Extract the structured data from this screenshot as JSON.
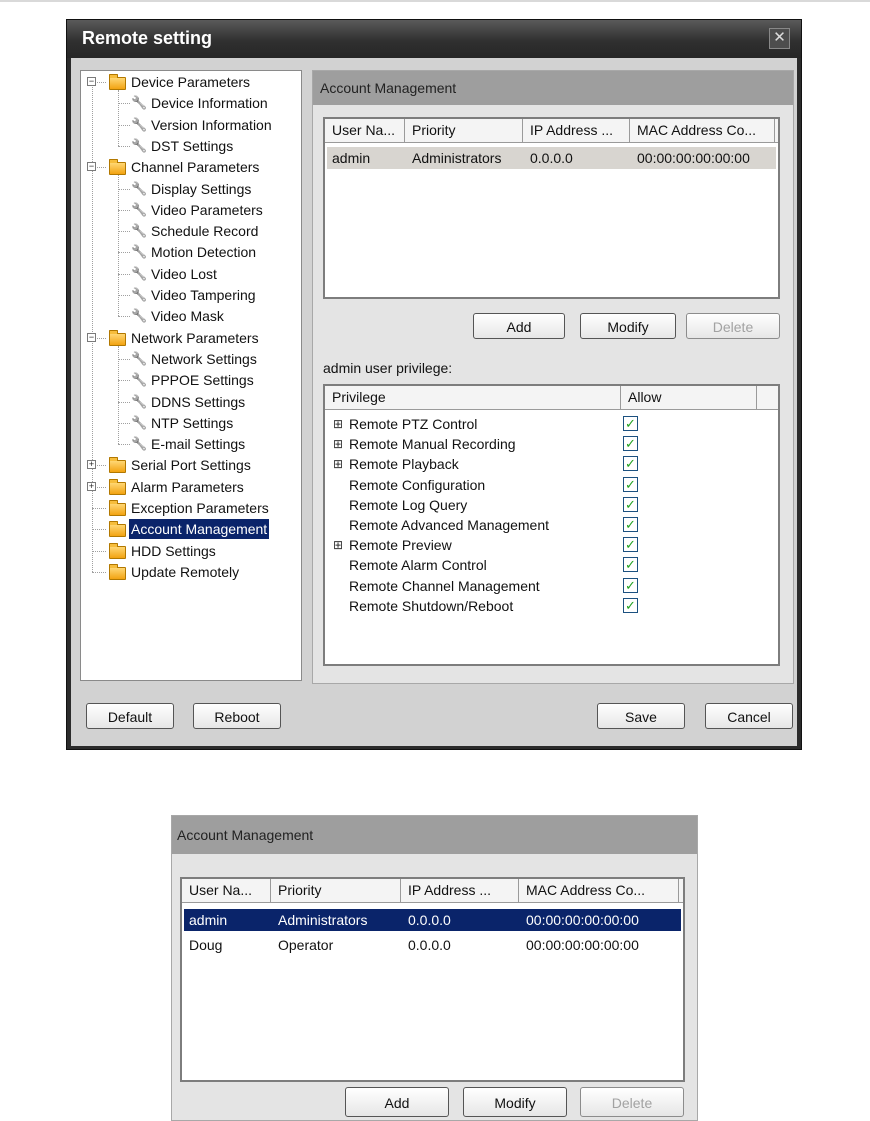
{
  "dialog": {
    "title": "Remote setting",
    "close_glyph": "✕",
    "buttons": {
      "default": "Default",
      "reboot": "Reboot",
      "save": "Save",
      "cancel": "Cancel"
    }
  },
  "tree": [
    {
      "label": "Device Parameters",
      "type": "folder",
      "level": 0,
      "expander": "−"
    },
    {
      "label": "Device Information",
      "type": "leaf",
      "level": 1
    },
    {
      "label": "Version Information",
      "type": "leaf",
      "level": 1
    },
    {
      "label": "DST Settings",
      "type": "leaf",
      "level": 1
    },
    {
      "label": "Channel Parameters",
      "type": "folder",
      "level": 0,
      "expander": "−"
    },
    {
      "label": "Display Settings",
      "type": "leaf",
      "level": 1
    },
    {
      "label": "Video Parameters",
      "type": "leaf",
      "level": 1
    },
    {
      "label": "Schedule Record",
      "type": "leaf",
      "level": 1
    },
    {
      "label": "Motion Detection",
      "type": "leaf",
      "level": 1
    },
    {
      "label": "Video Lost",
      "type": "leaf",
      "level": 1
    },
    {
      "label": "Video Tampering",
      "type": "leaf",
      "level": 1
    },
    {
      "label": "Video Mask",
      "type": "leaf",
      "level": 1
    },
    {
      "label": "Network Parameters",
      "type": "folder",
      "level": 0,
      "expander": "−"
    },
    {
      "label": "Network Settings",
      "type": "leaf",
      "level": 1
    },
    {
      "label": "PPPOE Settings",
      "type": "leaf",
      "level": 1
    },
    {
      "label": "DDNS Settings",
      "type": "leaf",
      "level": 1
    },
    {
      "label": "NTP Settings",
      "type": "leaf",
      "level": 1
    },
    {
      "label": "E-mail Settings",
      "type": "leaf",
      "level": 1
    },
    {
      "label": "Serial Port Settings",
      "type": "folder",
      "level": 0,
      "expander": "+"
    },
    {
      "label": "Alarm Parameters",
      "type": "folder",
      "level": 0,
      "expander": "+"
    },
    {
      "label": "Exception Parameters",
      "type": "folder",
      "level": 0
    },
    {
      "label": "Account Management",
      "type": "folder",
      "level": 0,
      "selected": true
    },
    {
      "label": "HDD Settings",
      "type": "folder",
      "level": 0
    },
    {
      "label": "Update Remotely",
      "type": "folder",
      "level": 0
    }
  ],
  "account": {
    "header": "Account Management",
    "columns": [
      "User Na...",
      "Priority",
      "IP Address ...",
      "MAC Address Co..."
    ],
    "rows": [
      [
        "admin",
        "Administrators",
        "0.0.0.0",
        "00:00:00:00:00:00"
      ]
    ],
    "buttons": {
      "add": "Add",
      "modify": "Modify",
      "delete": "Delete"
    },
    "privilege_caption": "admin user privilege:",
    "privilege_columns": [
      "Privilege",
      "Allow"
    ],
    "privileges": [
      {
        "label": "Remote PTZ Control",
        "expandable": true,
        "allowed": true
      },
      {
        "label": "Remote Manual Recording",
        "expandable": true,
        "allowed": true
      },
      {
        "label": "Remote Playback",
        "expandable": true,
        "allowed": true
      },
      {
        "label": "Remote Configuration",
        "expandable": false,
        "allowed": true
      },
      {
        "label": "Remote Log Query",
        "expandable": false,
        "allowed": true
      },
      {
        "label": "Remote Advanced Management",
        "expandable": false,
        "allowed": true
      },
      {
        "label": "Remote Preview",
        "expandable": true,
        "allowed": true
      },
      {
        "label": "Remote Alarm Control",
        "expandable": false,
        "allowed": true
      },
      {
        "label": "Remote Channel Management",
        "expandable": false,
        "allowed": true
      },
      {
        "label": "Remote Shutdown/Reboot",
        "expandable": false,
        "allowed": true
      }
    ]
  },
  "account2": {
    "header": "Account Management",
    "columns": [
      "User Na...",
      "Priority",
      "IP Address ...",
      "MAC Address Co..."
    ],
    "rows": [
      [
        "admin",
        "Administrators",
        "0.0.0.0",
        "00:00:00:00:00:00"
      ],
      [
        "Doug",
        "Operator",
        "0.0.0.0",
        "00:00:00:00:00:00"
      ]
    ],
    "buttons": {
      "add": "Add",
      "modify": "Modify",
      "delete": "Delete"
    }
  },
  "glyphs": {
    "plus": "⊞",
    "check": "✓",
    "wrench": "wrench-icon",
    "folder": "folder-icon"
  },
  "colors": {
    "selection": "#0a246a",
    "check": "#21a121"
  }
}
